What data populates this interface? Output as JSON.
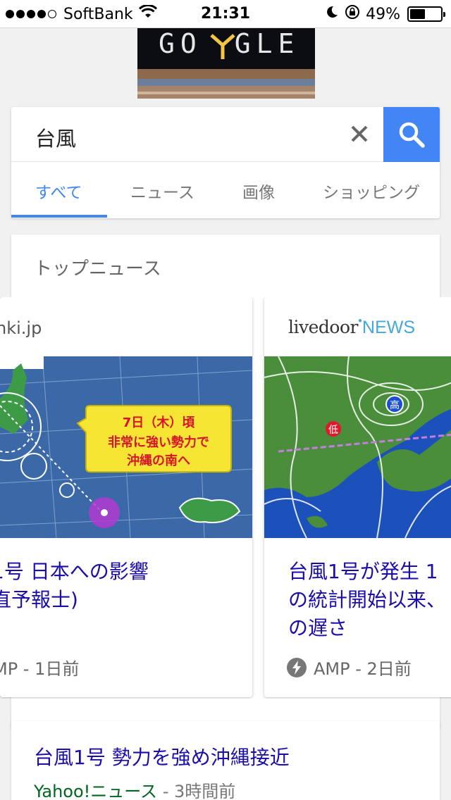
{
  "status_bar": {
    "carrier": "SoftBank",
    "time": "21:31",
    "battery": "49%",
    "battery_level": 0.49,
    "signal_bars": 4,
    "icons": [
      "wifi-icon",
      "moon-icon",
      "rotation-lock-icon",
      "battery-icon"
    ]
  },
  "doodle": {
    "text_left": "GO",
    "text_right": "GLE"
  },
  "search": {
    "query": "台風",
    "clear_icon": "close-icon",
    "search_icon": "search-icon",
    "accent_color": "#4285f4"
  },
  "tabs": [
    {
      "label": "すべて",
      "active": true
    },
    {
      "label": "ニュース",
      "active": false
    },
    {
      "label": "画像",
      "active": false
    },
    {
      "label": "ショッピング",
      "active": false
    }
  ],
  "top_news": {
    "title": "トップニュース",
    "items": [
      {
        "source": "nki.jp",
        "image_label_line1": "7日（木）頃",
        "image_label_line2": "非常に強い勢力で",
        "image_label_line3": "沖縄の南へ",
        "headline_line1": "1号 日本への影響",
        "headline_line2": "直予報士)",
        "meta": "MP - 1日前"
      },
      {
        "source_logo_a": "livedoor",
        "source_logo_b": "NEWS",
        "map_label_low": "低",
        "map_label_high": "高",
        "headline_line1": "台風1号が発生 1",
        "headline_line2": "の統計開始以来、",
        "headline_line3": "の遅さ",
        "meta": "AMP - 2日前",
        "amp_icon": "amp-lightning-icon"
      }
    ]
  },
  "result": {
    "title": "台風1号 勢力を強め沖縄接近",
    "source": "Yahoo!ニュース",
    "time": " - 3時間前"
  }
}
